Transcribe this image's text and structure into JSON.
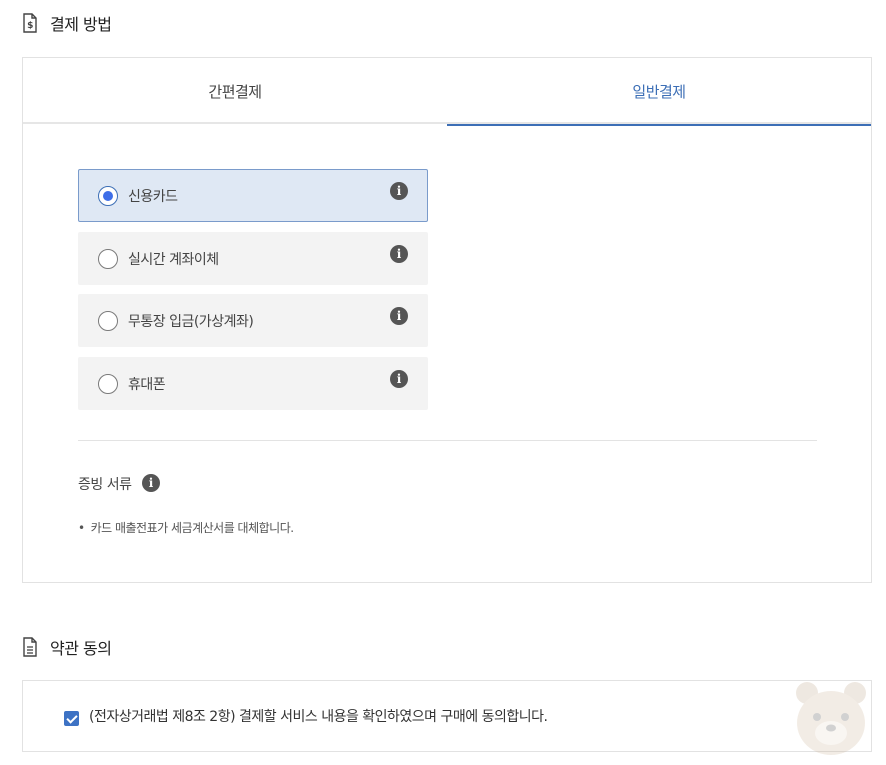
{
  "payment_section": {
    "title": "결제 방법",
    "icon": "receipt-dollar-icon",
    "tabs": [
      {
        "label": "간편결제",
        "active": false
      },
      {
        "label": "일반결제",
        "active": true
      }
    ],
    "methods": [
      {
        "label": "신용카드",
        "selected": true
      },
      {
        "label": "실시간 계좌이체",
        "selected": false
      },
      {
        "label": "무통장 입금(가상계좌)",
        "selected": false
      },
      {
        "label": "휴대폰",
        "selected": false
      }
    ],
    "info_glyph": "i",
    "receipt": {
      "label": "증빙 서류",
      "bullet": "•",
      "note": "카드 매출전표가 세금계산서를 대체합니다."
    }
  },
  "terms_section": {
    "title": "약관 동의",
    "icon": "document-icon",
    "agreement_text": "(전자상거래법 제8조 2항) 결제할 서비스 내용을 확인하였으며 구매에 동의합니다.",
    "checked": true
  },
  "colors": {
    "accent": "#3d6fb6",
    "selected_bg": "#dfe8f4",
    "unselected_bg": "#f3f3f3",
    "radio_fill": "#3e6ee8",
    "checkbox_fill": "#3d72c4"
  }
}
